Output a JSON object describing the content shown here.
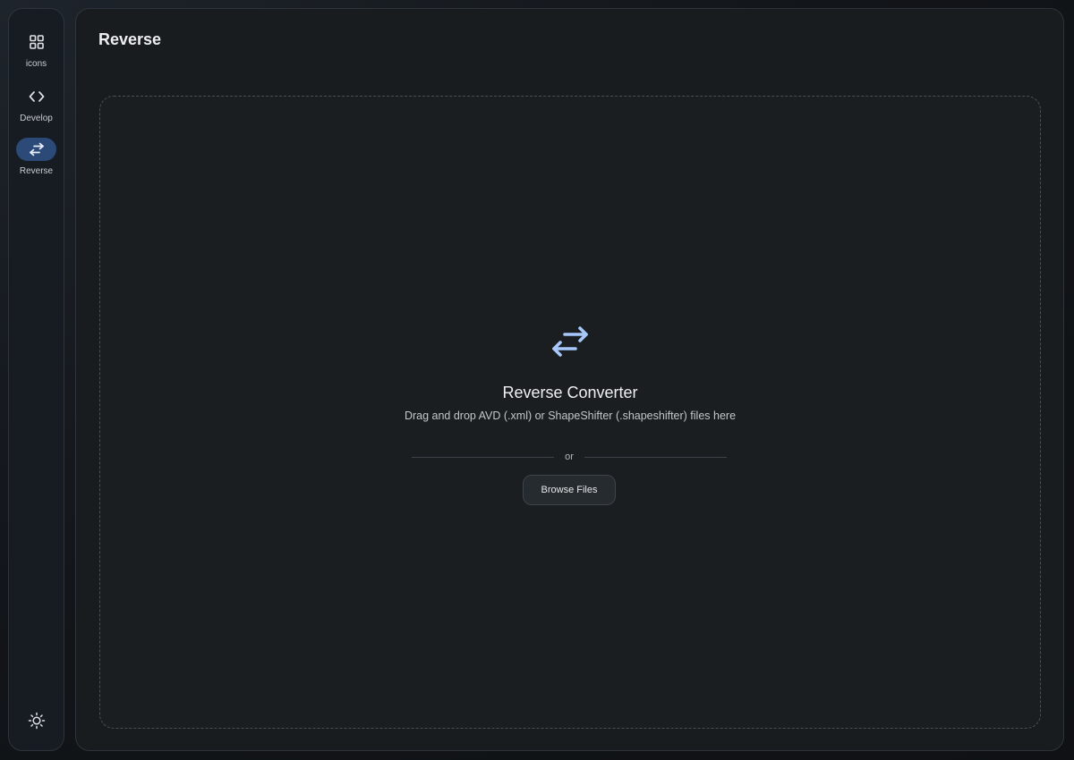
{
  "sidebar": {
    "items": [
      {
        "label": "icons",
        "icon": "grid-icon",
        "active": false
      },
      {
        "label": "Develop",
        "icon": "code-icon",
        "active": false
      },
      {
        "label": "Reverse",
        "icon": "swap-arrows-icon",
        "active": true
      }
    ],
    "theme_toggle_icon": "sun-icon"
  },
  "header": {
    "title": "Reverse"
  },
  "dropzone": {
    "icon": "swap-arrows-icon",
    "title": "Reverse Converter",
    "subtitle": "Drag and drop AVD (.xml) or ShapeShifter (.shapeshifter) files here",
    "divider_text": "or",
    "browse_label": "Browse Files"
  },
  "colors": {
    "accent": "#a8c7fa",
    "active_pill": "#2c4a78",
    "panel_bg": "#181c1f"
  }
}
